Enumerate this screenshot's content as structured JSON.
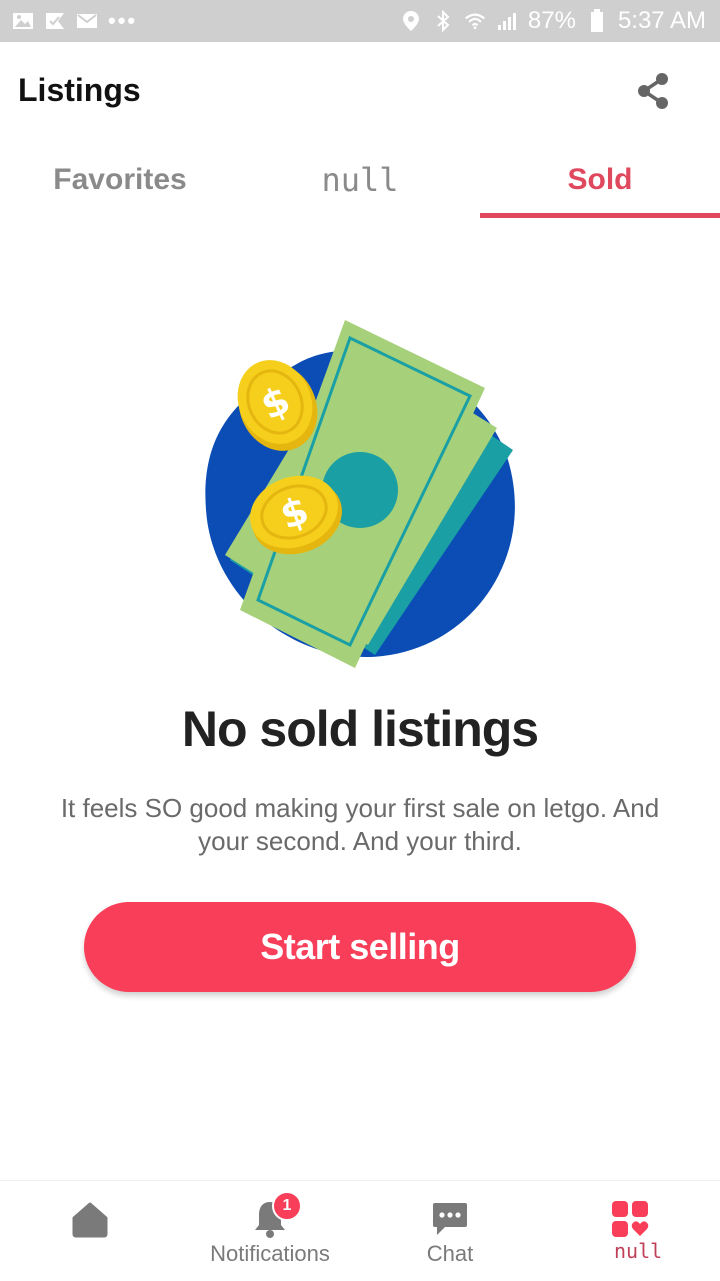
{
  "status_bar": {
    "dots": "•••",
    "battery": "87%",
    "time": "5:37 AM"
  },
  "header": {
    "title": "Listings"
  },
  "tabs": [
    {
      "label": "Favorites",
      "active": false
    },
    {
      "label": "null",
      "active": false
    },
    {
      "label": "Sold",
      "active": true
    }
  ],
  "empty_state": {
    "title": "No sold listings",
    "description": "It feels SO good making your first sale on letgo. And your second. And your third.",
    "button_label": "Start selling"
  },
  "bottom_nav": {
    "items": [
      {
        "label": "",
        "icon": "home-icon"
      },
      {
        "label": "Notifications",
        "icon": "bell-icon",
        "badge": "1"
      },
      {
        "label": "Chat",
        "icon": "chat-icon"
      },
      {
        "label": "null",
        "icon": "my-listings-icon"
      }
    ]
  },
  "colors": {
    "accent": "#f83e58",
    "tab_active": "#e0485e",
    "blob": "#0b4db5",
    "bill": "#a6d17a",
    "teal": "#1a9fa5",
    "coin": "#f5cf1c"
  }
}
